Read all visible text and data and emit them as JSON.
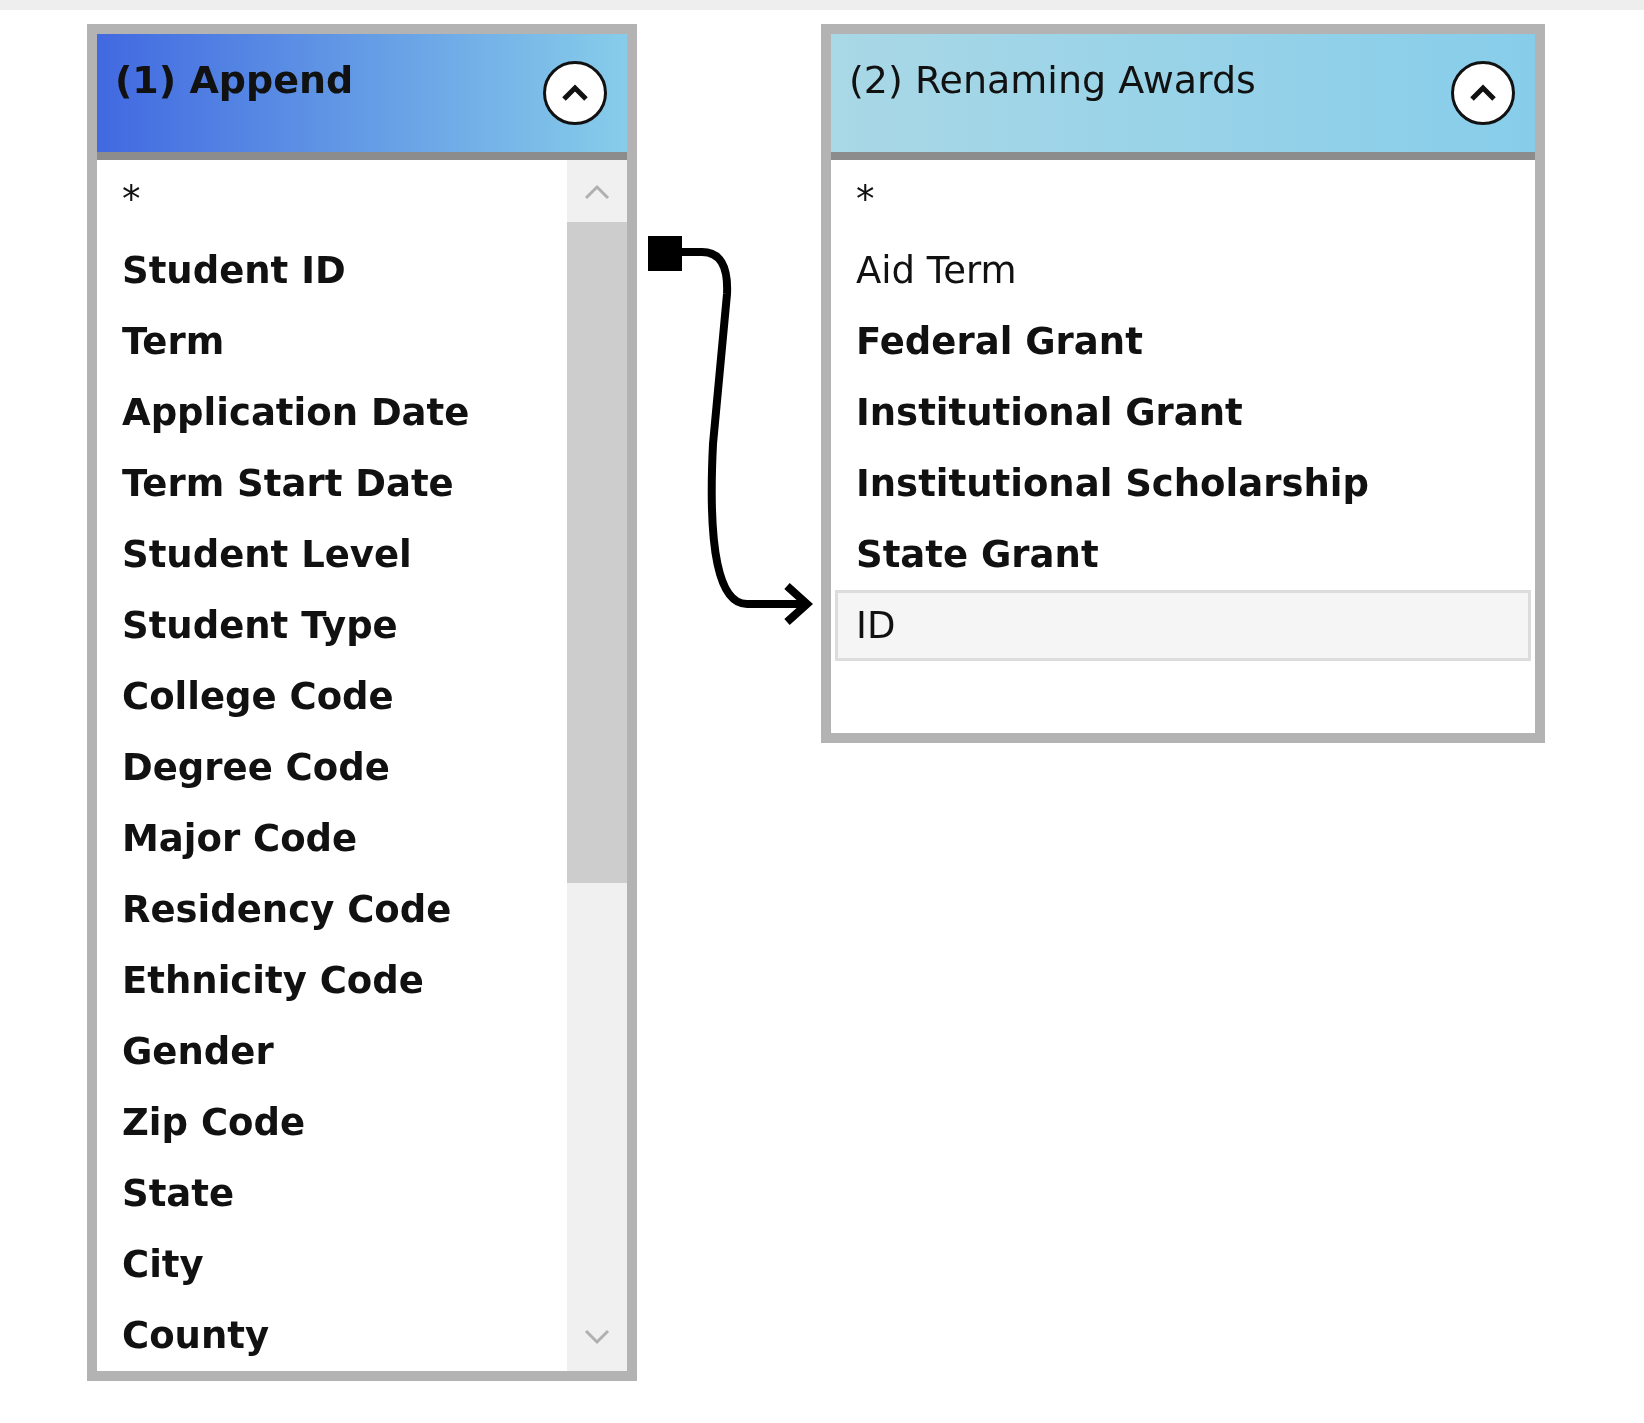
{
  "tables": [
    {
      "title": "(1) Append",
      "active": true,
      "fields": [
        {
          "name": "*",
          "bold": false,
          "selected": false
        },
        {
          "name": "Student ID",
          "bold": true,
          "selected": false
        },
        {
          "name": "Term",
          "bold": true,
          "selected": false
        },
        {
          "name": "Application Date",
          "bold": true,
          "selected": false
        },
        {
          "name": "Term Start Date",
          "bold": true,
          "selected": false
        },
        {
          "name": "Student Level",
          "bold": true,
          "selected": false
        },
        {
          "name": "Student Type",
          "bold": true,
          "selected": false
        },
        {
          "name": "College Code",
          "bold": true,
          "selected": false
        },
        {
          "name": "Degree Code",
          "bold": true,
          "selected": false
        },
        {
          "name": "Major Code",
          "bold": true,
          "selected": false
        },
        {
          "name": "Residency Code",
          "bold": true,
          "selected": false
        },
        {
          "name": "Ethnicity Code",
          "bold": true,
          "selected": false
        },
        {
          "name": "Gender",
          "bold": true,
          "selected": false
        },
        {
          "name": "Zip Code",
          "bold": true,
          "selected": false
        },
        {
          "name": "State",
          "bold": true,
          "selected": false
        },
        {
          "name": "City",
          "bold": true,
          "selected": false
        },
        {
          "name": "County",
          "bold": true,
          "selected": false
        }
      ]
    },
    {
      "title": "(2) Renaming Awards",
      "active": false,
      "fields": [
        {
          "name": "*",
          "bold": false,
          "selected": false
        },
        {
          "name": "Aid Term",
          "bold": false,
          "selected": false
        },
        {
          "name": "Federal Grant",
          "bold": true,
          "selected": false
        },
        {
          "name": "Institutional Grant",
          "bold": true,
          "selected": false
        },
        {
          "name": "Institutional Scholarship",
          "bold": true,
          "selected": false
        },
        {
          "name": "State Grant",
          "bold": true,
          "selected": false
        },
        {
          "name": "ID",
          "bold": false,
          "selected": true
        }
      ]
    }
  ]
}
